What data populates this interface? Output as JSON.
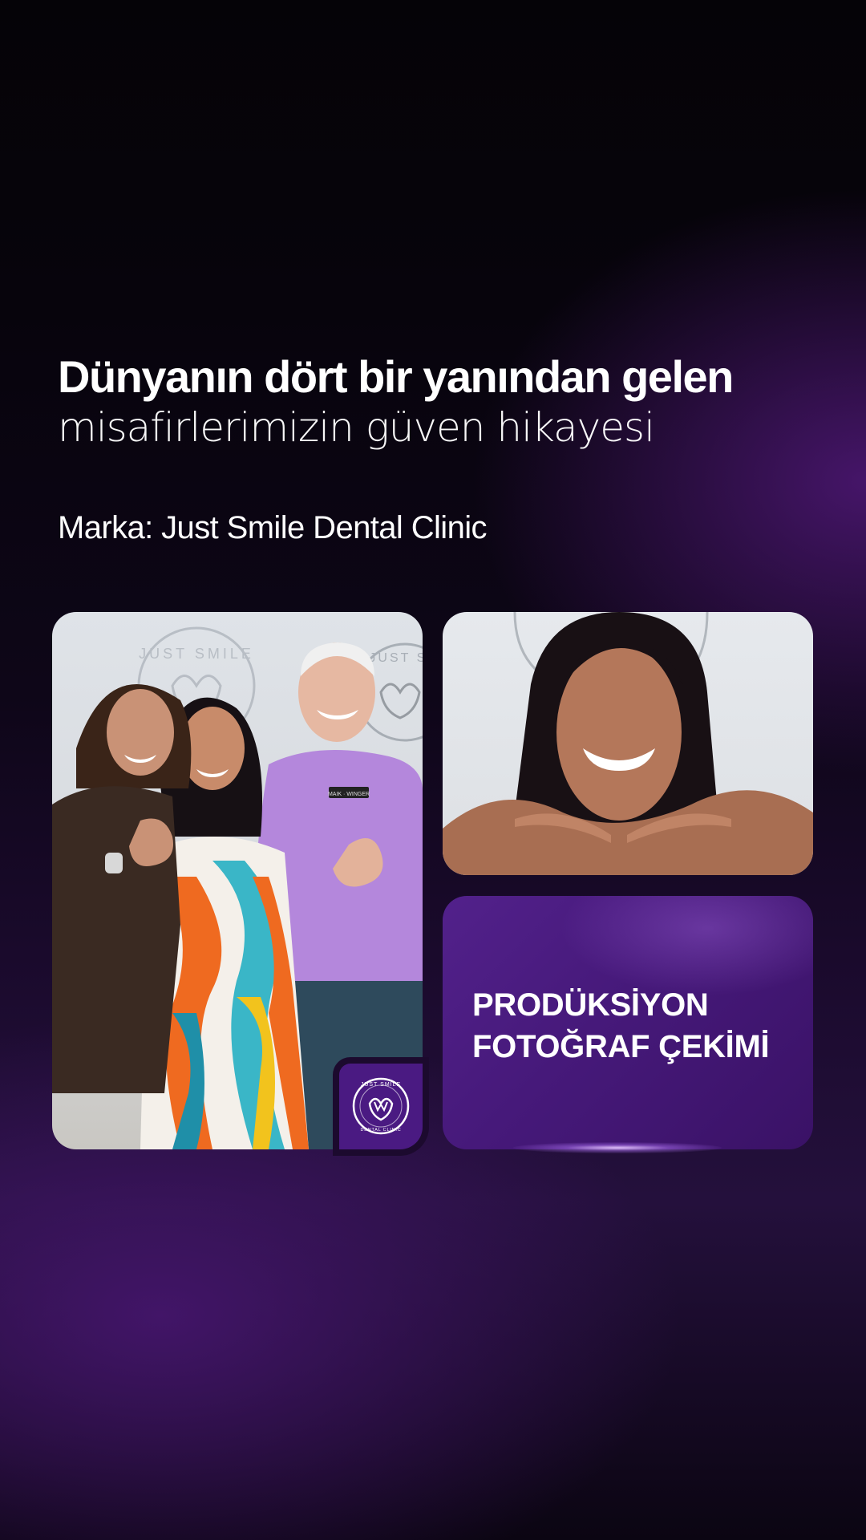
{
  "headline": {
    "line1": "Dünyanın dört bir yanından gelen",
    "line2": "misafirlerimizin güven hikayesi"
  },
  "brand_line": "Marka: Just Smile Dental Clinic",
  "promo": {
    "line1": "PRODÜKSİYON",
    "line2": "FOTOĞRAF ÇEKİMİ"
  },
  "photos": {
    "group": "group-photo",
    "portrait": "portrait-photo"
  },
  "logo": {
    "top_text": "JUST SMILE",
    "bottom_text": "DENTAL CLINIC",
    "wall_text_1": "JUST SMILE",
    "wall_text_2": "JUST SM",
    "shirt_badge": "MAIK · WINGER"
  },
  "colors": {
    "promo_purple": "#4a1a82",
    "background_dark": "#07040c",
    "accent_glow": "#b98cf0"
  }
}
